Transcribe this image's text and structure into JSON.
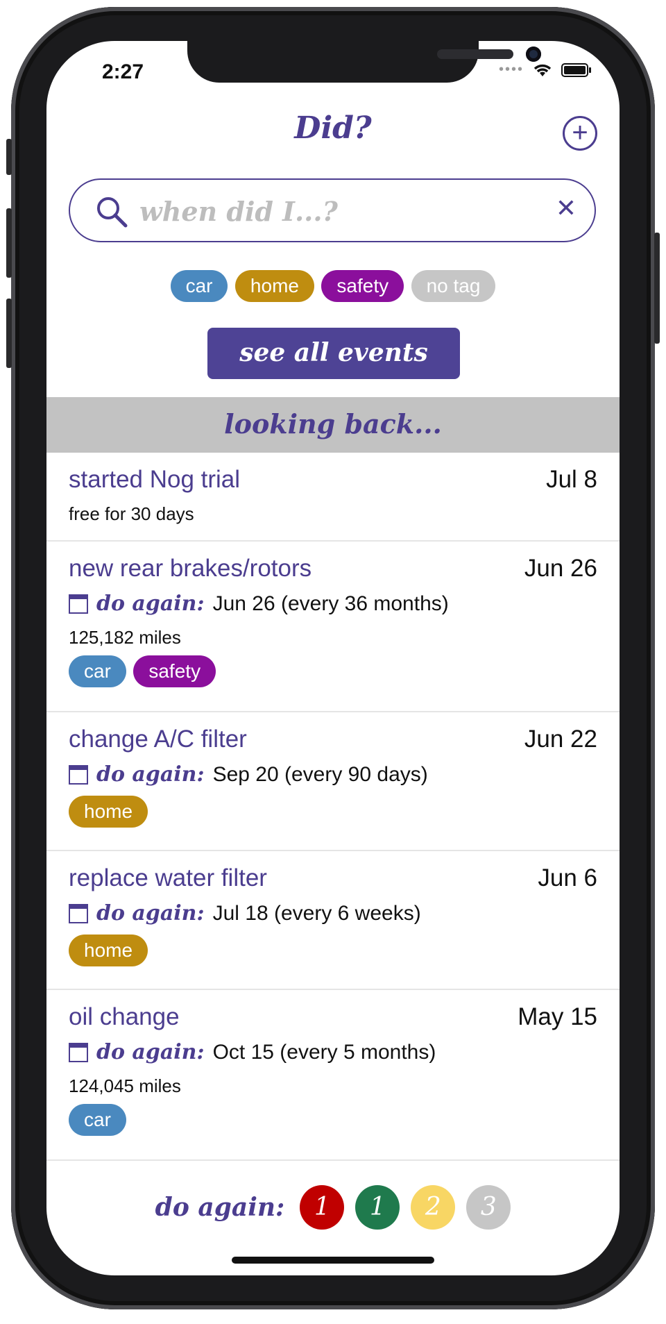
{
  "status": {
    "time": "2:27"
  },
  "header": {
    "title": "Did?"
  },
  "search": {
    "placeholder": "when did I...?"
  },
  "tag_filters": [
    {
      "label": "car",
      "color": "#4a89bf"
    },
    {
      "label": "home",
      "color": "#bf8d10"
    },
    {
      "label": "safety",
      "color": "#8b0f9c"
    },
    {
      "label": "no tag",
      "color": "#c6c6c6"
    }
  ],
  "see_all_label": "see all events",
  "section_header": "looking back...",
  "events": [
    {
      "title": "started Nog trial",
      "date": "Jul 8",
      "note": "free for 30 days"
    },
    {
      "title": "new rear brakes/rotors",
      "date": "Jun 26",
      "again_label": "do again:",
      "again": "Jun 26 (every 36 months)",
      "note": "125,182 miles",
      "tags": [
        "car",
        "safety"
      ]
    },
    {
      "title": "change A/C filter",
      "date": "Jun 22",
      "again_label": "do again:",
      "again": "Sep 20 (every 90 days)",
      "tags": [
        "home"
      ]
    },
    {
      "title": "replace water filter",
      "date": "Jun 6",
      "again_label": "do again:",
      "again": "Jul 18 (every 6 weeks)",
      "tags": [
        "home"
      ]
    },
    {
      "title": "oil change",
      "date": "May 15",
      "again_label": "do again:",
      "again": "Oct 15 (every 5 months)",
      "note": "124,045 miles",
      "tags": [
        "car"
      ]
    }
  ],
  "footer": {
    "label": "do again:",
    "badges": [
      {
        "count": "1",
        "color": "#c00000"
      },
      {
        "count": "1",
        "color": "#1f7a4d"
      },
      {
        "count": "2",
        "color": "#f8d664"
      },
      {
        "count": "3",
        "color": "#c6c6c6"
      }
    ]
  }
}
